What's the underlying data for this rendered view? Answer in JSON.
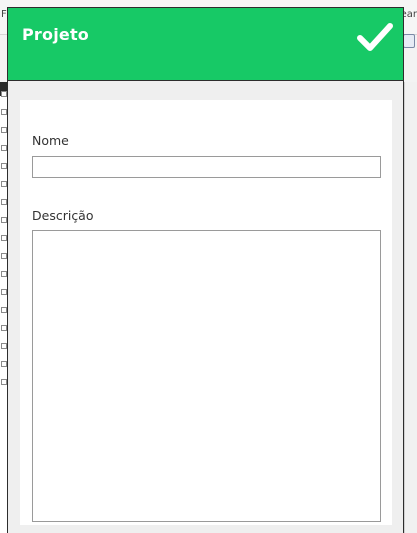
{
  "background_app": {
    "menu_left_text": "F",
    "menu_right_text": "ear"
  },
  "panel": {
    "title": "Projeto",
    "confirm_icon": "checkmark-icon",
    "header_color": "#17c966"
  },
  "form": {
    "name_label": "Nome",
    "name_value": "",
    "description_label": "Descrição",
    "description_value": ""
  }
}
